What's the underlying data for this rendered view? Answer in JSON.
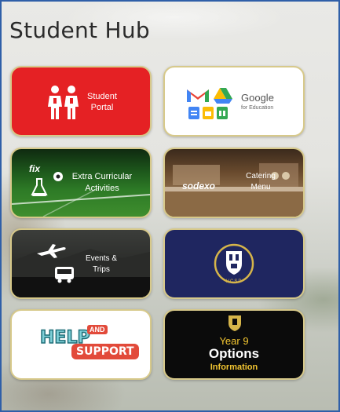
{
  "title": "Student Hub",
  "tiles": [
    {
      "line1": "Student",
      "line2": "Portal"
    },
    {
      "brand": "Google",
      "sub": "for Education"
    },
    {
      "line1": "Extra Curricular",
      "line2": "Activities",
      "marker": "fix"
    },
    {
      "line1": "Catering",
      "line2": "Menu",
      "brand": "sodexo"
    },
    {
      "line1": "Events &",
      "line2": "Trips"
    },
    {
      "crest_text": "HCSP"
    },
    {
      "line1": "HELP",
      "line2": "AND",
      "line3": "SUPPORT"
    },
    {
      "line1": "Year 9",
      "line2": "Options",
      "line3": "Information"
    }
  ],
  "colors": {
    "border": "#2f5fa8",
    "gold": "#d7c98a",
    "portal_red": "#e52124",
    "crest_blue": "#1f2660",
    "year9_yellow": "#f2c531"
  }
}
